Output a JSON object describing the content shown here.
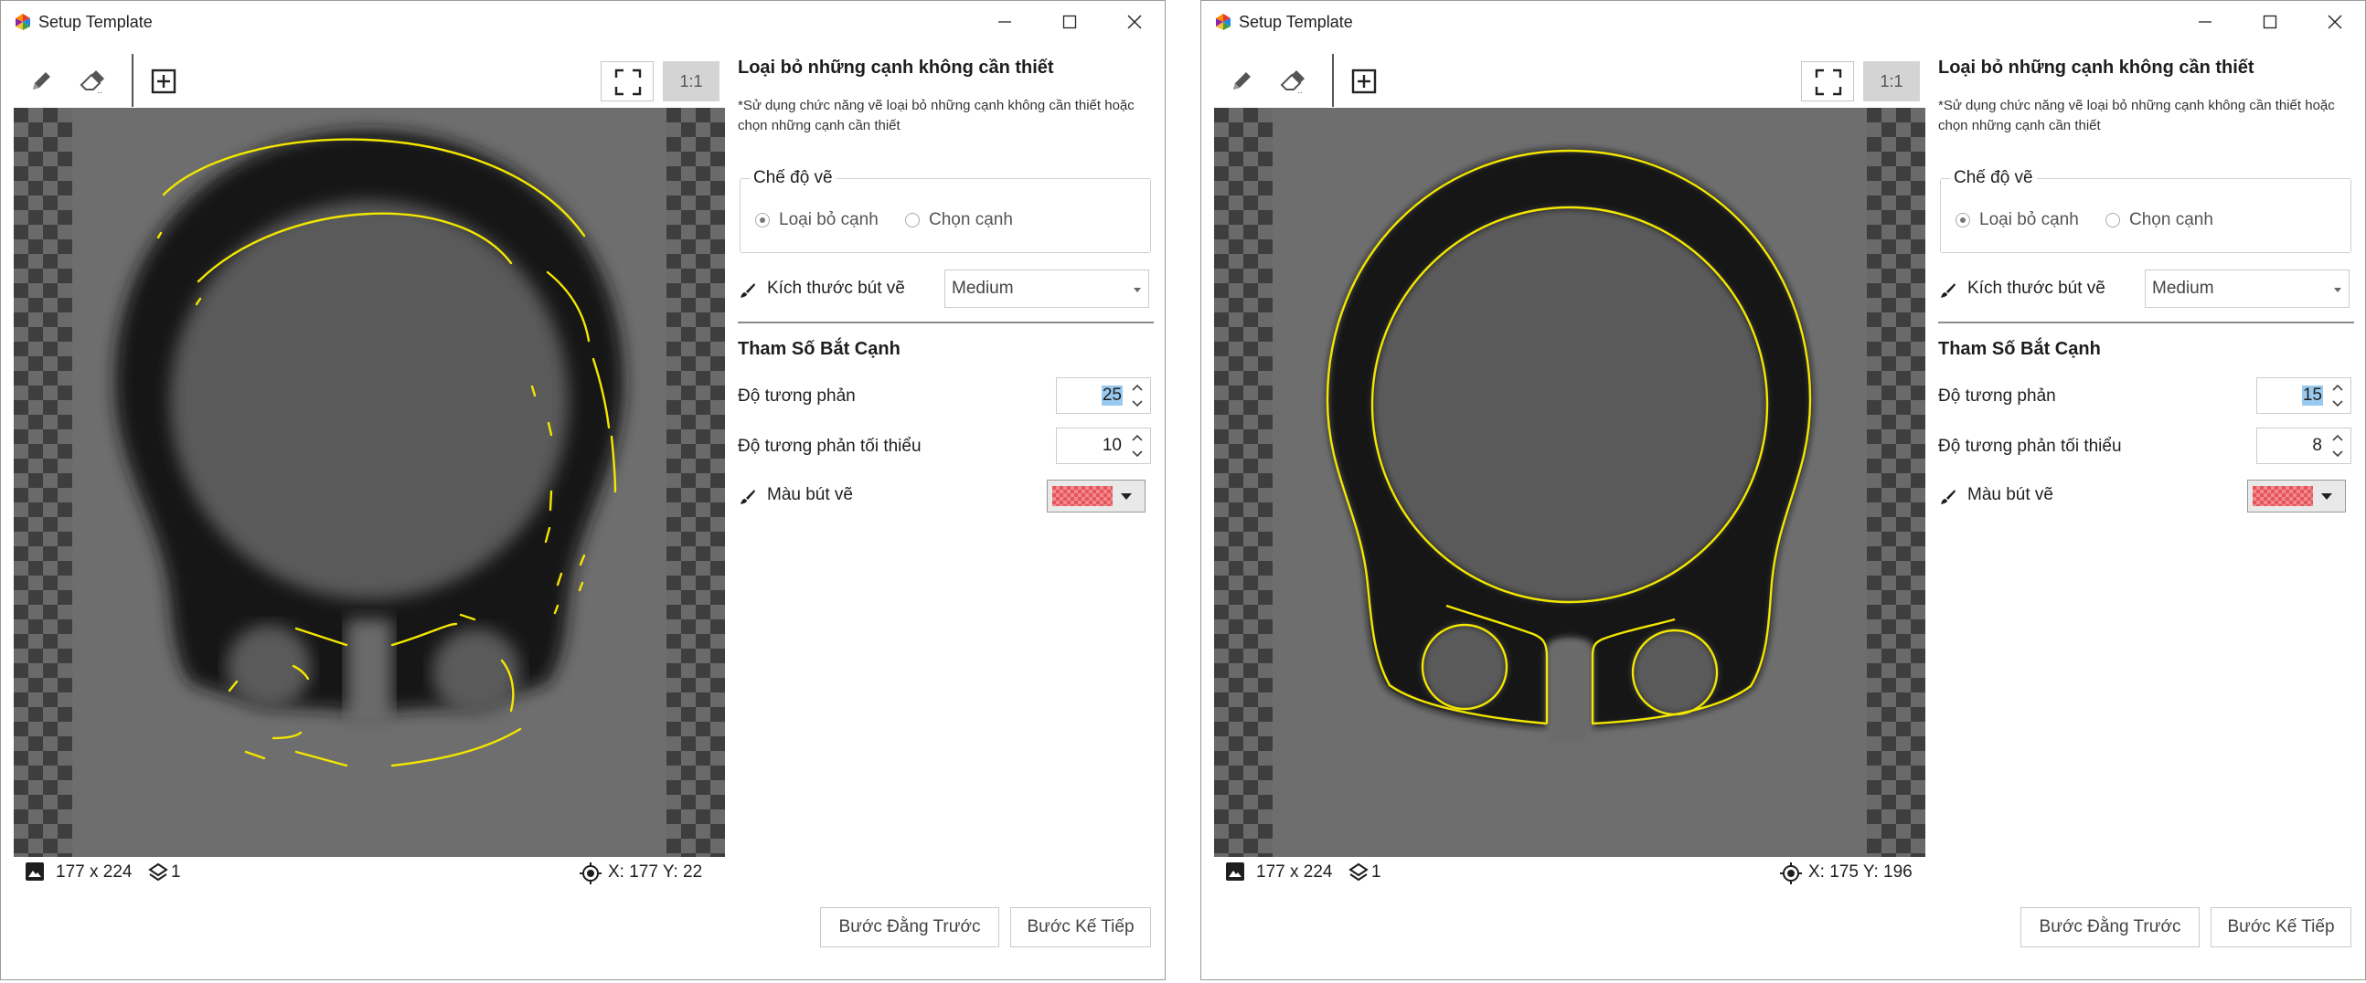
{
  "windows": [
    {
      "title": "Setup Template",
      "toolbar": {
        "one_to_one_label": "1:1"
      },
      "status": {
        "size": "177 x 224",
        "layers": "1",
        "coords": "X: 177 Y: 22"
      },
      "panel": {
        "title": "Loại bỏ những cạnh không cần thiết",
        "description": "*Sử dụng chức năng vẽ loại bỏ những cạnh không cần thiết hoặc chọn những cạnh cần thiết",
        "draw_mode": {
          "legend": "Chế độ vẽ",
          "options": [
            "Loại bỏ cạnh",
            "Chọn cạnh"
          ],
          "selected": "Loại bỏ cạnh"
        },
        "brush_size": {
          "label": "Kích thước bút vẽ",
          "value": "Medium"
        },
        "edge_section_title": "Tham Số Bắt Cạnh",
        "contrast": {
          "label": "Độ tương phản",
          "value": "25"
        },
        "min_contrast": {
          "label": "Độ tương phản tối thiểu",
          "value": "10"
        },
        "brush_color": {
          "label": "Màu bút vẽ",
          "color": "#e6555a"
        }
      },
      "buttons": {
        "prev": "Bước Đằng Trước",
        "next": "Bước Kế Tiếp"
      }
    },
    {
      "title": "Setup Template",
      "toolbar": {
        "one_to_one_label": "1:1"
      },
      "status": {
        "size": "177 x 224",
        "layers": "1",
        "coords": "X: 175 Y: 196"
      },
      "panel": {
        "title": "Loại bỏ những cạnh không cần thiết",
        "description": "*Sử dụng chức năng vẽ loại bỏ những cạnh không cần thiết hoặc chọn những cạnh cần thiết",
        "draw_mode": {
          "legend": "Chế độ vẽ",
          "options": [
            "Loại bỏ cạnh",
            "Chọn cạnh"
          ],
          "selected": "Loại bỏ cạnh"
        },
        "brush_size": {
          "label": "Kích thước bút vẽ",
          "value": "Medium"
        },
        "edge_section_title": "Tham Số Bắt Cạnh",
        "contrast": {
          "label": "Độ tương phản",
          "value": "15"
        },
        "min_contrast": {
          "label": "Độ tương phản tối thiểu",
          "value": "8"
        },
        "brush_color": {
          "label": "Màu bút vẽ",
          "color": "#e6555a"
        }
      },
      "buttons": {
        "prev": "Bước Đằng Trước",
        "next": "Bước Kế Tiếp"
      }
    }
  ],
  "icons": {
    "app": "app-logo-icon",
    "minimize": "minimize-icon",
    "maximize": "maximize-icon",
    "close": "close-icon",
    "pencil": "pencil-icon",
    "eraser": "eraser-icon",
    "add": "add-box-icon",
    "fit": "fit-screen-icon",
    "image": "image-icon",
    "layers": "layers-icon",
    "crosshair": "crosshair-icon",
    "brush": "brush-icon"
  },
  "colors": {
    "edge_overlay": "#f3e600",
    "selection": "#99c9ef"
  }
}
